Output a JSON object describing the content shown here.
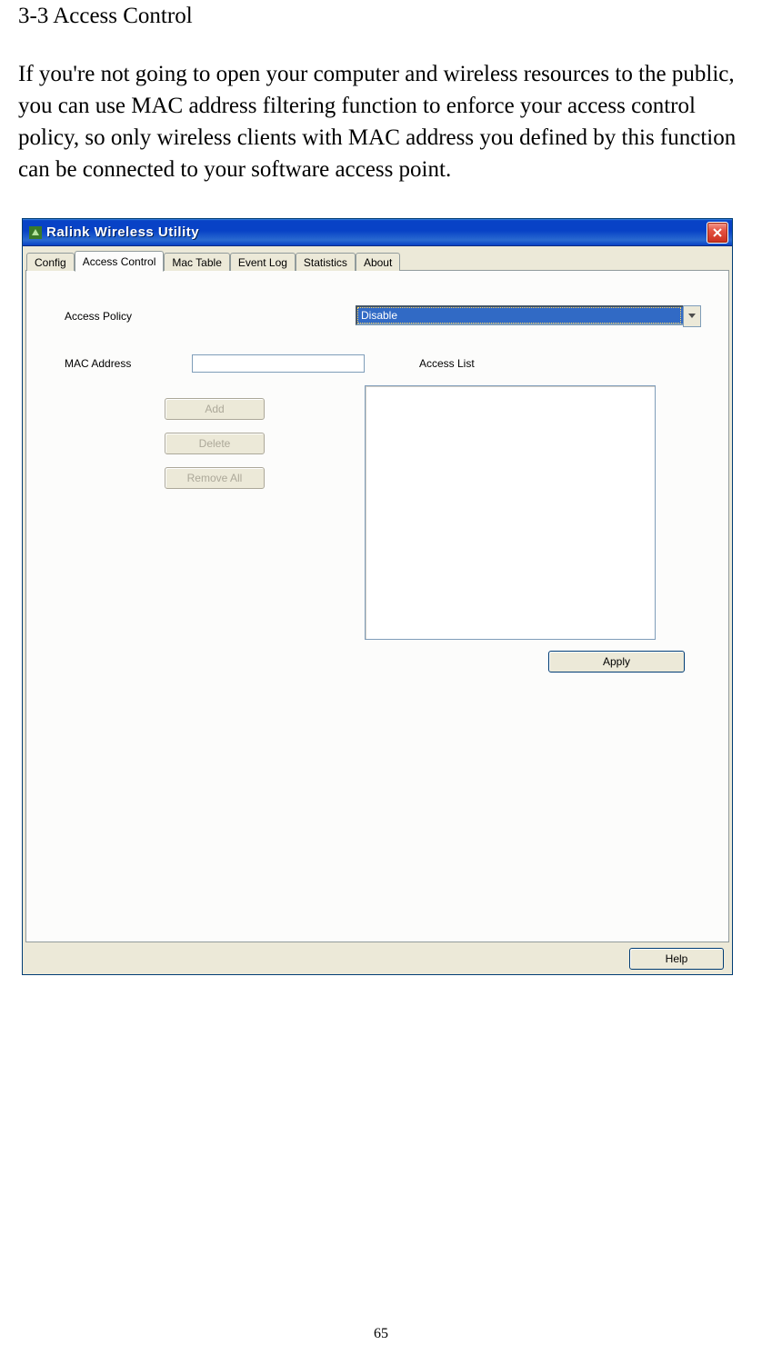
{
  "doc": {
    "heading": "3-3 Access Control",
    "body": "If you're not going to open your computer and wireless resources to the public, you can use MAC address filtering function to enforce your access control policy, so only wireless clients with MAC address you defined by this function can be connected to your software access point.",
    "page_number": "65"
  },
  "window": {
    "title": "Ralink Wireless Utility",
    "tabs": [
      "Config",
      "Access Control",
      "Mac Table",
      "Event Log",
      "Statistics",
      "About"
    ],
    "active_tab_index": 1,
    "labels": {
      "access_policy": "Access Policy",
      "mac_address": "MAC Address",
      "access_list": "Access List"
    },
    "policy": {
      "selected": "Disable",
      "options": [
        "Disable"
      ]
    },
    "mac_input_value": "",
    "buttons": {
      "add": "Add",
      "delete": "Delete",
      "remove_all": "Remove All",
      "apply": "Apply",
      "help": "Help"
    },
    "access_list_items": []
  }
}
